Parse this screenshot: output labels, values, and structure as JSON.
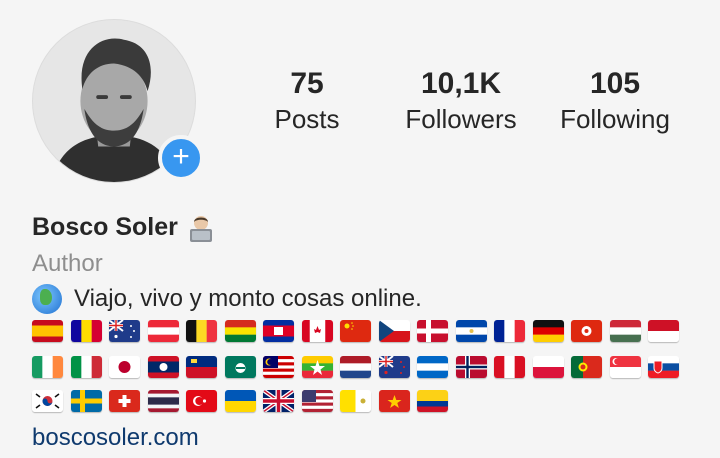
{
  "profile": {
    "name": "Bosco Soler",
    "name_emoji": "technologist-emoji",
    "category": "Author",
    "bio": "Viajo, vivo y monto cosas online.",
    "bio_icon": "globe-icon",
    "website": "boscosoler.com",
    "avatar_badge": "+"
  },
  "stats": {
    "posts": {
      "value": "75",
      "label": "Posts"
    },
    "followers": {
      "value": "10,1K",
      "label": "Followers"
    },
    "following": {
      "value": "105",
      "label": "Following"
    }
  },
  "colors": {
    "accent": "#3897f0",
    "text": "#262626",
    "muted": "#8e8e8e",
    "link": "#0f3a6e",
    "background": "#f5f5f5"
  },
  "flags": {
    "row1": [
      "es",
      "ad",
      "au",
      "at",
      "be",
      "bo",
      "kh",
      "ca",
      "cn",
      "cz",
      "dk",
      "sv",
      "fr",
      "de",
      "hk",
      "hu",
      "id"
    ],
    "row2": [
      "ie",
      "it",
      "jp",
      "la",
      "li",
      "mo",
      "my",
      "mm",
      "nl",
      "nz",
      "ni",
      "no",
      "pe",
      "pl",
      "pt",
      "sg",
      "sk"
    ],
    "row3": [
      "kr",
      "se",
      "ch",
      "th",
      "tr",
      "ua",
      "gb",
      "us",
      "va",
      "vn",
      "co"
    ]
  }
}
